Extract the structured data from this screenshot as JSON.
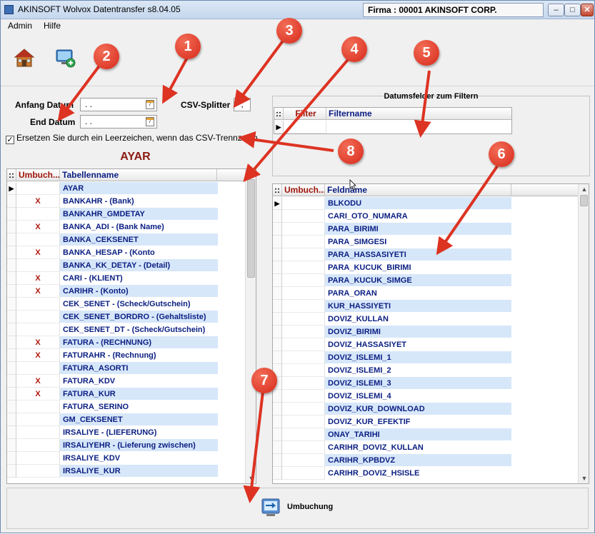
{
  "window": {
    "title": "AKINSOFT Wolvox Datentransfer s8.04.05",
    "firma": "Firma : 00001 AKINSOFT CORP.",
    "controls": {
      "minimize": "–",
      "maximize": "□",
      "close": "✕"
    }
  },
  "menu": [
    "Admin",
    "Hilfe"
  ],
  "toolbar": {
    "icons": [
      "home-icon",
      "transfer-icon"
    ]
  },
  "form": {
    "anfang_label": "Anfang Datum",
    "anfang_value": ". .",
    "end_label": "End Datum",
    "end_value": ". .",
    "calendar_glyph": "7",
    "csv_label": "CSV-Splitter",
    "csv_value": ";",
    "checkbox_checked": true,
    "checkbox_mark": "✓",
    "checkbox_label": "Ersetzen Sie durch ein Leerzeichen, wenn das CSV-Trennzeich"
  },
  "left_table": {
    "title": "AYAR",
    "headers": {
      "marker": "::",
      "umbuch": "Umbuch...",
      "name": "Tabellenname"
    },
    "rows": [
      {
        "name": "AYAR",
        "x": ""
      },
      {
        "name": "BANKAHR - (Bank)",
        "x": "X"
      },
      {
        "name": "BANKAHR_GMDETAY",
        "x": ""
      },
      {
        "name": "BANKA_ADI - (Bank Name)",
        "x": "X"
      },
      {
        "name": "BANKA_CEKSENET",
        "x": ""
      },
      {
        "name": "BANKA_HESAP - (Konto",
        "x": "X"
      },
      {
        "name": "BANKA_KK_DETAY - (Detail)",
        "x": ""
      },
      {
        "name": "CARI - (KLIENT)",
        "x": "X"
      },
      {
        "name": "CARIHR - (Konto)",
        "x": "X"
      },
      {
        "name": "CEK_SENET - (Scheck/Gutschein)",
        "x": ""
      },
      {
        "name": "CEK_SENET_BORDRO - (Gehaltsliste)",
        "x": ""
      },
      {
        "name": "CEK_SENET_DT - (Scheck/Gutschein)",
        "x": ""
      },
      {
        "name": "FATURA - (RECHNUNG)",
        "x": "X"
      },
      {
        "name": "FATURAHR - (Rechnung)",
        "x": "X"
      },
      {
        "name": "FATURA_ASORTI",
        "x": ""
      },
      {
        "name": "FATURA_KDV",
        "x": "X"
      },
      {
        "name": "FATURA_KUR",
        "x": "X"
      },
      {
        "name": "FATURA_SERINO",
        "x": ""
      },
      {
        "name": "GM_CEKSENET",
        "x": ""
      },
      {
        "name": "IRSALIYE - (LIEFERUNG)",
        "x": ""
      },
      {
        "name": "IRSALIYEHR - (Lieferung zwischen)",
        "x": ""
      },
      {
        "name": "IRSALIYE_KDV",
        "x": ""
      },
      {
        "name": "IRSALIYE_KUR",
        "x": ""
      }
    ]
  },
  "date_filter": {
    "title": "Datumsfelder zum Filtern",
    "headers": {
      "marker": "::",
      "filter": "Filter",
      "name": "Filtername"
    }
  },
  "field_table": {
    "headers": {
      "marker": "::",
      "umbuch": "Umbuch...",
      "name": "Feldname"
    },
    "rows": [
      "BLKODU",
      "CARI_OTO_NUMARA",
      "PARA_BIRIMI",
      "PARA_SIMGESI",
      "PARA_HASSASIYETI",
      "PARA_KUCUK_BIRIMI",
      "PARA_KUCUK_SIMGE",
      "PARA_ORAN",
      "KUR_HASSIYETI",
      "DOVIZ_KULLAN",
      "DOVIZ_BIRIMI",
      "DOVIZ_HASSASIYET",
      "DOVIZ_ISLEMI_1",
      "DOVIZ_ISLEMI_2",
      "DOVIZ_ISLEMI_3",
      "DOVIZ_ISLEMI_4",
      "DOVIZ_KUR_DOWNLOAD",
      "DOVIZ_KUR_EFEKTIF",
      "ONAY_TARIHI",
      "CARIHR_DOVIZ_KULLAN",
      "CARIHR_KPBDVZ",
      "CARIHR_DOVIZ_HSISLE"
    ]
  },
  "umbuchung_button": "Umbuchung",
  "row_indicator": "▶",
  "scroll": {
    "up": "▲",
    "down": "▼"
  },
  "callouts": [
    "1",
    "2",
    "3",
    "4",
    "5",
    "6",
    "7",
    "8"
  ],
  "colors": {
    "callout": "#d8291b",
    "row_highlight": "#d7e7fa",
    "name_text": "#0a1e82",
    "marker_x": "#b0160c",
    "title_red": "#8b1a10"
  }
}
